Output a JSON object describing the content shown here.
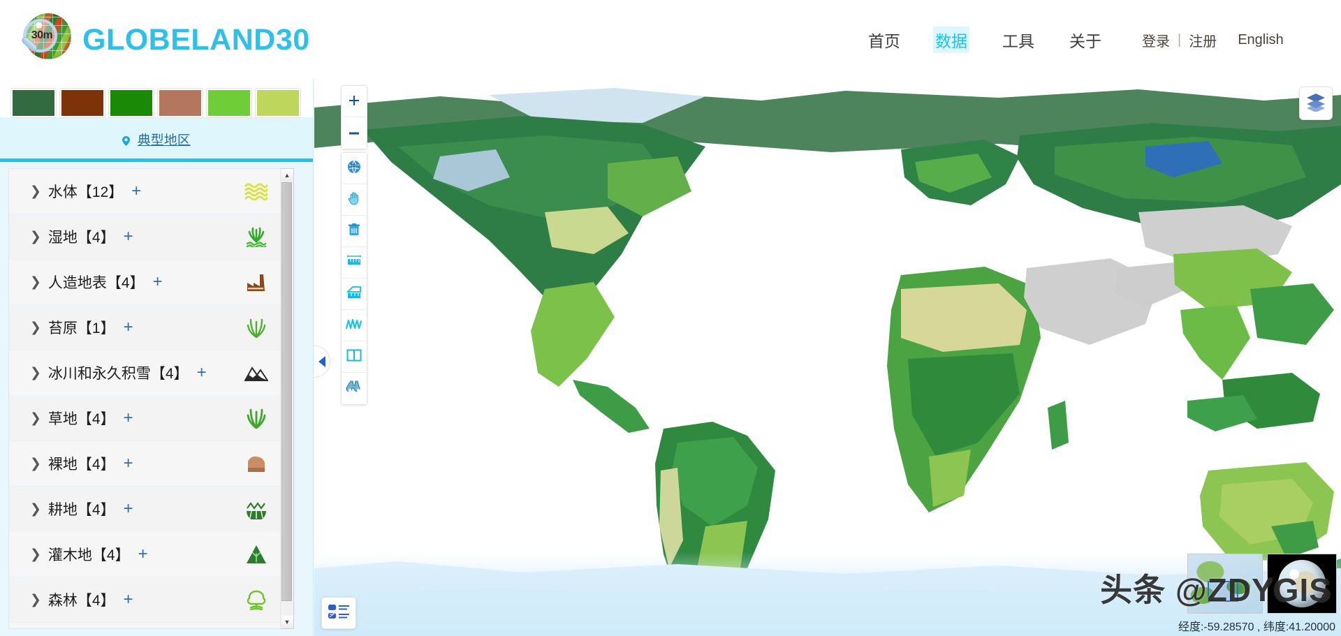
{
  "header": {
    "logo_badge": "30m",
    "brand": "GLOBELAND30",
    "nav": [
      {
        "label": "首页",
        "active": false
      },
      {
        "label": "数据",
        "active": true
      },
      {
        "label": "工具",
        "active": false
      },
      {
        "label": "关于",
        "active": false
      }
    ],
    "user": {
      "login": "登录",
      "separator": "|",
      "register": "注册",
      "language": "English"
    }
  },
  "sidebar": {
    "swatches": [
      {
        "name": "forest-dark-green",
        "color": "#326b3f"
      },
      {
        "name": "artificial-brown",
        "color": "#7d3208"
      },
      {
        "name": "cultivated-green",
        "color": "#1a8a06"
      },
      {
        "name": "bareland-salmon",
        "color": "#b4765e"
      },
      {
        "name": "grassland-lime",
        "color": "#6fce38"
      },
      {
        "name": "shrub-yellowgreen",
        "color": "#bfd65c"
      }
    ],
    "region_link": {
      "label": "典型地区",
      "icon": "map-pin-icon"
    },
    "layers": [
      {
        "name": "水体",
        "count": "【12】",
        "plus": "+",
        "icon": "water-waves-icon",
        "icon_color": "#d9e24a"
      },
      {
        "name": "湿地",
        "count": "【4】",
        "plus": "+",
        "icon": "wetland-grass-icon",
        "icon_color": "#2faa28"
      },
      {
        "name": "人造地表",
        "count": "【4】",
        "plus": "+",
        "icon": "factory-icon",
        "icon_color": "#8a4a1e"
      },
      {
        "name": "苔原",
        "count": "【1】",
        "plus": "+",
        "icon": "tundra-grass-icon",
        "icon_color": "#4fae33"
      },
      {
        "name": "冰川和永久积雪",
        "count": "【4】",
        "plus": "+",
        "icon": "snow-mountain-icon",
        "icon_color": "#2b2b2b"
      },
      {
        "name": "草地",
        "count": "【4】",
        "plus": "+",
        "icon": "grass-icon",
        "icon_color": "#3fa82c"
      },
      {
        "name": "裸地",
        "count": "【4】",
        "plus": "+",
        "icon": "bareland-icon",
        "icon_color": "#c98f63"
      },
      {
        "name": "耕地",
        "count": "【4】",
        "plus": "+",
        "icon": "cultivated-field-icon",
        "icon_color": "#2f7d2a"
      },
      {
        "name": "灌木地",
        "count": "【4】",
        "plus": "+",
        "icon": "shrub-tree-icon",
        "icon_color": "#2c7a35"
      },
      {
        "name": "森林",
        "count": "【4】",
        "plus": "+",
        "icon": "forest-tree-icon",
        "icon_color": "#6fc42b"
      }
    ],
    "collapse_icon": "collapse-left-arrow-icon",
    "scroll_up_icon": "▲",
    "scroll_down_icon": "▼"
  },
  "map": {
    "zoom_controls": [
      {
        "name": "zoom-in-button",
        "glyph": "+"
      },
      {
        "name": "zoom-out-button",
        "glyph": "−"
      }
    ],
    "tools": [
      {
        "name": "globe-3d-tool",
        "icon": "globe-icon"
      },
      {
        "name": "pan-tool",
        "icon": "hand-icon"
      },
      {
        "name": "clear-tool",
        "icon": "trash-icon"
      },
      {
        "name": "measure-distance-tool",
        "icon": "ruler-icon"
      },
      {
        "name": "measure-area-tool",
        "icon": "area-icon"
      },
      {
        "name": "profile-tool",
        "icon": "waveform-icon"
      },
      {
        "name": "swipe-compare-tool",
        "icon": "split-panel-icon"
      },
      {
        "name": "inspect-tool",
        "icon": "binoculars-icon"
      }
    ],
    "layers_button": {
      "name": "layers-button",
      "icon": "layers-stack-icon"
    },
    "legend_button": {
      "name": "legend-button",
      "icon": "legend-list-icon"
    },
    "overview": {
      "name": "overview-map",
      "icon": "mini-map-icon"
    },
    "globe_thumb": {
      "name": "globe-thumbnail",
      "icon": "globe-thumbnail-icon"
    },
    "coordinates": "经度:-59.28570 , 纬度:41.20000",
    "watermark": "头条 @ZDYGIS"
  }
}
